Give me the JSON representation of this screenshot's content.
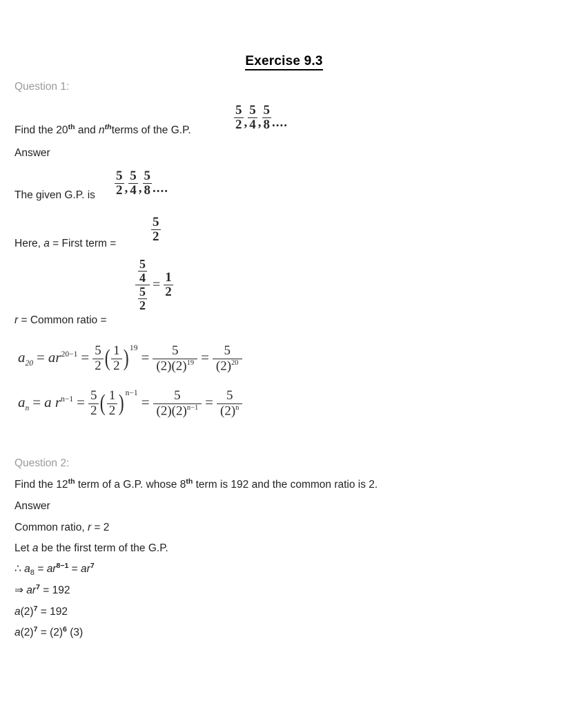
{
  "document": {
    "title": "Exercise 9.3",
    "background_color": "#ffffff",
    "text_color": "#231f20",
    "question_label_color": "#9a9a9a"
  },
  "questions": [
    {
      "label": "Question 1:",
      "prompt_prefix": "Find the 20",
      "prompt_sup1": "th",
      "prompt_mid": " and ",
      "prompt_var": "n",
      "prompt_sup2": "th",
      "prompt_suffix": "terms of the G.P.",
      "prompt_sequence": {
        "terms": [
          "5/2",
          "5/4",
          "5/8"
        ],
        "numerators": [
          "5",
          "5",
          "5"
        ],
        "denominators": [
          "2",
          "4",
          "8"
        ],
        "separator": ",",
        "trailing": "...."
      },
      "answer_label": "Answer",
      "steps": [
        {
          "text": "The given G.P. is",
          "sequence": {
            "numerators": [
              "5",
              "5",
              "5"
            ],
            "denominators": [
              "2",
              "4",
              "8"
            ],
            "separator": ",",
            "trailing": "...."
          }
        },
        {
          "text_prefix": "Here, ",
          "text_var": "a",
          "text_suffix": " = First term = ",
          "value_num": "5",
          "value_den": "2"
        },
        {
          "text_var": "r",
          "text_suffix": " = Common ratio = ",
          "complex_fraction": {
            "outer_num_num": "5",
            "outer_num_den": "4",
            "outer_den_num": "5",
            "outer_den_den": "2",
            "equals": "=",
            "result_num": "1",
            "result_den": "2"
          }
        }
      ],
      "equations": [
        {
          "lhs_var": "a",
          "lhs_sub": "20",
          "eq1_base": "ar",
          "eq1_exp": "20−1",
          "coef_num": "5",
          "coef_den": "2",
          "inner_num": "1",
          "inner_den": "2",
          "outer_exp": "19",
          "res1_num": "5",
          "res1_den_a": "(2)(2)",
          "res1_den_exp": "19",
          "res2_num": "5",
          "res2_den": "(2)",
          "res2_exp": "20"
        },
        {
          "lhs_var": "a",
          "lhs_sub": "n",
          "eq1_base": "a r",
          "eq1_exp": "n−1",
          "coef_num": "5",
          "coef_den": "2",
          "inner_num": "1",
          "inner_den": "2",
          "outer_exp": "n−1",
          "res1_num": "5",
          "res1_den_a": "(2)(2)",
          "res1_den_exp": "n−1",
          "res2_num": "5",
          "res2_den": "(2)",
          "res2_exp": "n"
        }
      ]
    },
    {
      "label": "Question 2:",
      "prompt_p1": "Find the 12",
      "prompt_s1": "th",
      "prompt_p2": " term of a G.P. whose 8",
      "prompt_s2": "th",
      "prompt_p3": " term is 192 and the common ratio is 2.",
      "answer_label": "Answer",
      "lines": [
        {
          "id": "common-ratio",
          "pre": "Common ratio, ",
          "var": "r",
          "post": " = 2"
        },
        {
          "id": "let-a",
          "pre": "Let ",
          "var": "a",
          "post": " be the first term of the G.P."
        },
        {
          "id": "a8-definition",
          "pre": "∴ ",
          "var": "a",
          "sub": "8",
          "mid": " = ",
          "var2": "ar",
          "sup2": "8−1",
          "mid2": " = ",
          "var3": "ar",
          "sup3": "7"
        },
        {
          "id": "ar7-equals-192",
          "pre": "⇒ ",
          "var": "ar",
          "sup": "7",
          "post": " = 192"
        },
        {
          "id": "a2-7-equals-192",
          "var": "a",
          "post1": "(2)",
          "sup": "7",
          "post2": " = 192"
        },
        {
          "id": "a2-7-equals-2-6-3",
          "var": "a",
          "post1": "(2)",
          "sup": "7",
          "post2": " = (2)",
          "sup2": "6",
          "post3": " (3)"
        }
      ]
    }
  ]
}
